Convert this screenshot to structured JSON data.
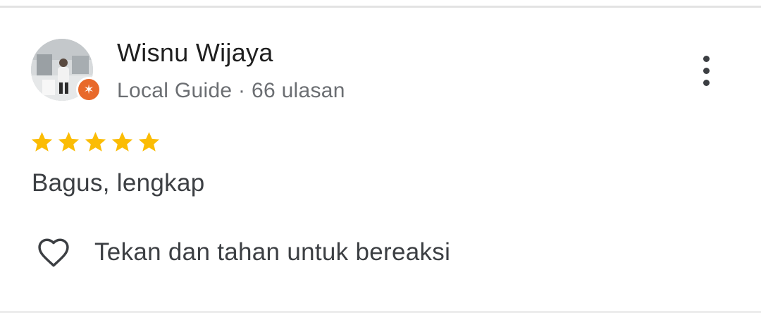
{
  "review": {
    "reviewer_name": "Wisnu Wijaya",
    "reviewer_meta": "Local Guide · 66 ulasan",
    "rating": 5,
    "rating_max": 5,
    "text": "Bagus, lengkap",
    "react_label": "Tekan dan tahan untuk bereaksi"
  },
  "icons": {
    "avatar": "reviewer-avatar-photo",
    "badge": "local-guide-star-badge",
    "menu": "more-vertical-icon",
    "star": "star-icon",
    "react": "heart-outline-icon"
  },
  "colors": {
    "star": "#fbbc04",
    "badge": "#e8692b",
    "name": "#1f1f1f",
    "meta": "#6b6e72",
    "body": "#3c3f43"
  }
}
